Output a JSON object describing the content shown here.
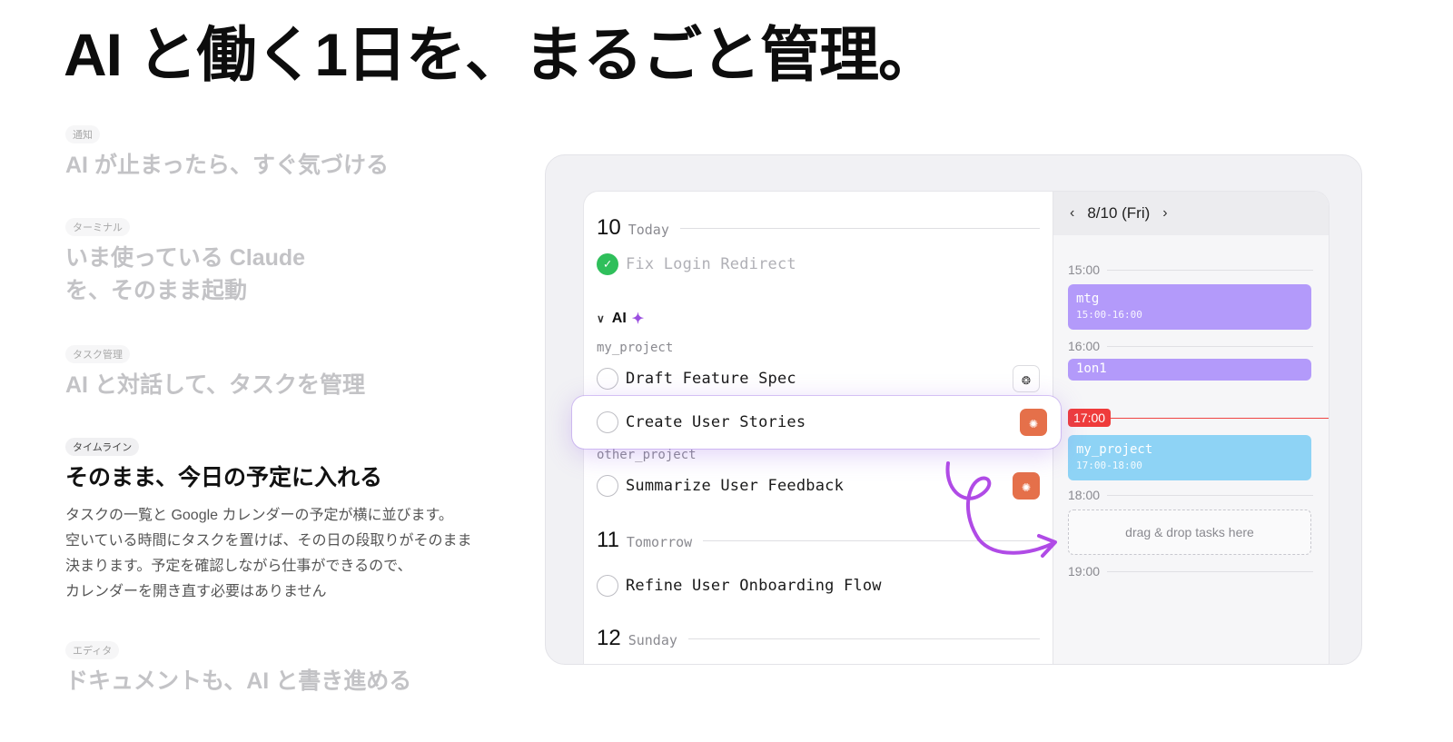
{
  "headline": "AI と働く1日を、まるごと管理。",
  "features": [
    {
      "tag": "通知",
      "title_lines": [
        "AI が止まったら、すぐ気づける"
      ]
    },
    {
      "tag": "ターミナル",
      "title_lines": [
        "いま使っている Claude",
        "を、そのまま起動"
      ]
    },
    {
      "tag": "タスク管理",
      "title_lines": [
        "AI と対話して、タスクを管理"
      ]
    },
    {
      "tag": "タイムライン",
      "title_lines": [
        "そのまま、今日の予定に入れる"
      ],
      "desc_lines": [
        "タスクの一覧と Google カレンダーの予定が横に並びます。",
        "空いている時間にタスクを置けば、その日の段取りがそのまま",
        "決まります。予定を確認しながら仕事ができるので、",
        "カレンダーを開き直す必要はありません"
      ]
    },
    {
      "tag": "エディタ",
      "title_lines": [
        "ドキュメントも、AI と書き進める"
      ]
    }
  ],
  "tasks": {
    "days": [
      {
        "num": "10",
        "label": "Today"
      },
      {
        "num": "11",
        "label": "Tomorrow"
      },
      {
        "num": "12",
        "label": "Sunday"
      }
    ],
    "done_task": "Fix Login Redirect",
    "group_label": "AI",
    "group_spark_icon": "sparkle-icon",
    "projects": [
      "my_project",
      "other_project"
    ],
    "items": [
      "Draft Feature Spec",
      "Create User Stories",
      "Summarize User Feedback",
      "Refine User Onboarding Flow"
    ]
  },
  "calendar": {
    "date": "8/10 (Fri)",
    "times": [
      "15:00",
      "16:00",
      "18:00",
      "19:00"
    ],
    "now": "17:00",
    "events": [
      {
        "name": "mtg",
        "time": "15:00-16:00",
        "color": "#b39afa"
      },
      {
        "name": "1on1",
        "time": "",
        "color": "#b39afa"
      },
      {
        "name": "my_project",
        "time": "17:00-18:00",
        "color": "#8ed3f5"
      }
    ],
    "drop_hint": "drag & drop tasks here"
  },
  "colors": {
    "accent_purple": "#9b4fe0",
    "check_green": "#2fbf5b",
    "claude_orange": "#e5704a",
    "now_red": "#ef3b3b"
  }
}
